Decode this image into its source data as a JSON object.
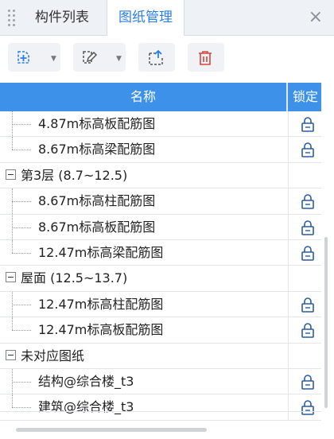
{
  "tabs": [
    {
      "label": "构件列表",
      "active": false
    },
    {
      "label": "图纸管理",
      "active": true
    }
  ],
  "colors": {
    "accent": "#2b7de9",
    "header_bg": "#3d91e8"
  },
  "toolbar": {
    "buttons": [
      {
        "icon": "add-sheet-icon",
        "has_dropdown": true
      },
      {
        "icon": "edit-sheet-icon",
        "has_dropdown": true
      },
      {
        "icon": "export-sheet-icon",
        "has_dropdown": false
      },
      {
        "icon": "delete-icon",
        "has_dropdown": false
      }
    ]
  },
  "table": {
    "columns": [
      "名称",
      "锁定"
    ],
    "rows": [
      {
        "type": "item",
        "label": "4.87m标高板配筋图",
        "locked": true
      },
      {
        "type": "item",
        "label": "8.67m标高梁配筋图",
        "locked": true
      },
      {
        "type": "group",
        "label": "第3层 (8.7~12.5)",
        "expanded": true
      },
      {
        "type": "item",
        "label": "8.67m标高柱配筋图",
        "locked": true
      },
      {
        "type": "item",
        "label": "8.67m标高板配筋图",
        "locked": true
      },
      {
        "type": "item",
        "label": "12.47m标高梁配筋图",
        "locked": true
      },
      {
        "type": "group",
        "label": "屋面 (12.5~13.7)",
        "expanded": true
      },
      {
        "type": "item",
        "label": "12.47m标高柱配筋图",
        "locked": true
      },
      {
        "type": "item",
        "label": "12.47m标高板配筋图",
        "locked": true
      },
      {
        "type": "group",
        "label": "未对应图纸",
        "expanded": true
      },
      {
        "type": "item",
        "label": "结构@综合楼_t3",
        "locked": true
      },
      {
        "type": "item",
        "label": "建筑@综合楼_t3",
        "locked": true
      }
    ]
  }
}
